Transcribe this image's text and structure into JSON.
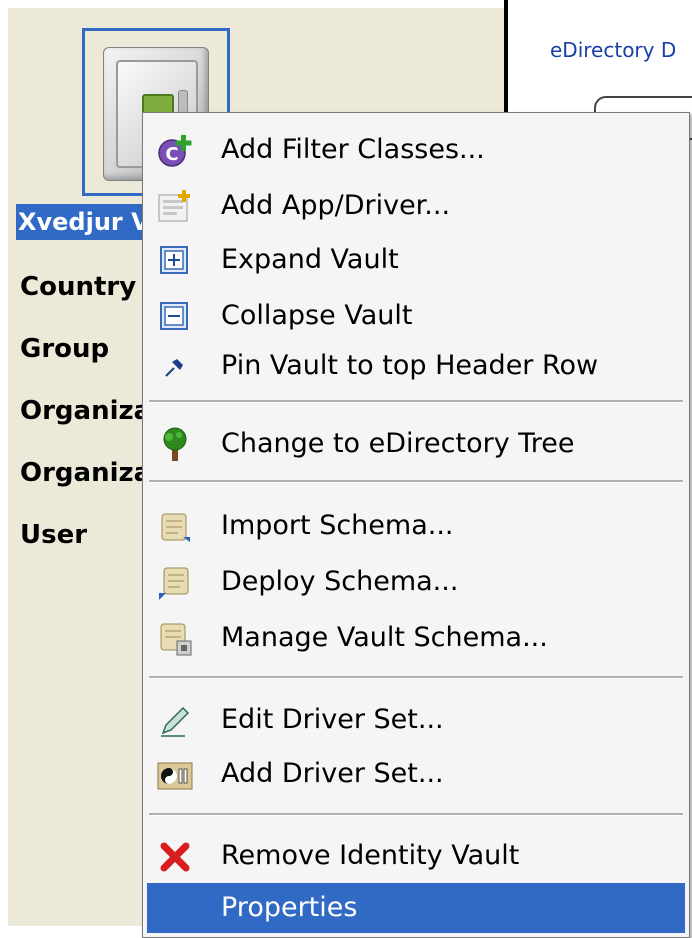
{
  "header": {
    "tree_label": "eDirectory D"
  },
  "vault": {
    "label": "Xvedjur V"
  },
  "class_list": [
    "Country",
    "Group",
    "Organiza",
    "Organiza",
    "User"
  ],
  "menu": {
    "items": [
      {
        "label": "Add Filter Classes...",
        "icon": "add-filter-classes-icon"
      },
      {
        "label": "Add App/Driver...",
        "icon": "add-app-driver-icon"
      },
      {
        "label": "Expand Vault",
        "icon": "expand-icon"
      },
      {
        "label": "Collapse Vault",
        "icon": "collapse-icon"
      },
      {
        "label": "Pin Vault to top Header Row",
        "icon": "pin-icon"
      },
      {
        "label": "Change to eDirectory Tree",
        "icon": "tree-icon"
      },
      {
        "label": "Import Schema...",
        "icon": "import-schema-icon"
      },
      {
        "label": "Deploy Schema...",
        "icon": "deploy-schema-icon"
      },
      {
        "label": "Manage Vault Schema...",
        "icon": "manage-schema-icon"
      },
      {
        "label": "Edit Driver Set...",
        "icon": "pencil-icon"
      },
      {
        "label": "Add Driver Set...",
        "icon": "add-driver-set-icon"
      },
      {
        "label": "Remove Identity Vault",
        "icon": "red-x-icon"
      },
      {
        "label": "Properties",
        "icon": ""
      }
    ],
    "selected_index": 12
  },
  "colors": {
    "selection": "#316AC5",
    "workspace": "#ECE9D8",
    "menu_bg": "#F5F5F5"
  }
}
